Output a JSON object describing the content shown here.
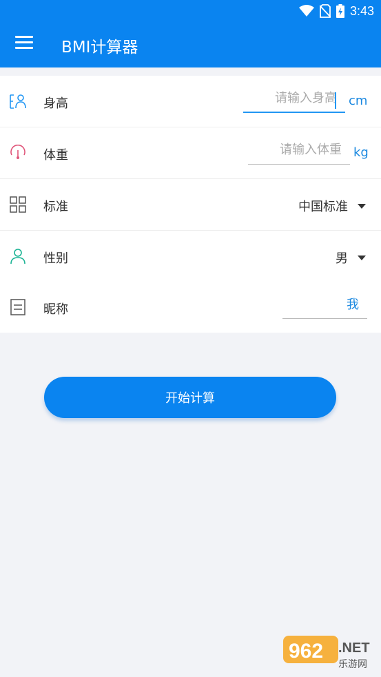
{
  "status_bar": {
    "time": "3:43"
  },
  "app": {
    "title": "BMI计算器"
  },
  "form": {
    "height": {
      "label": "身高",
      "placeholder": "请输入身高",
      "unit": "cm"
    },
    "weight": {
      "label": "体重",
      "placeholder": "请输入体重",
      "unit": "kg"
    },
    "standard": {
      "label": "标准",
      "value": "中国标准"
    },
    "gender": {
      "label": "性别",
      "value": "男"
    },
    "nickname": {
      "label": "昵称",
      "value": "我"
    }
  },
  "actions": {
    "start_label": "开始计算"
  },
  "watermark": {
    "logo_text": "962.NET",
    "sub_text": "乐游网"
  },
  "colors": {
    "primary": "#0a84f0",
    "accent": "#2196f3",
    "weight_icon": "#e0567a",
    "gender_icon": "#1ab394",
    "background": "#f2f3f7"
  }
}
